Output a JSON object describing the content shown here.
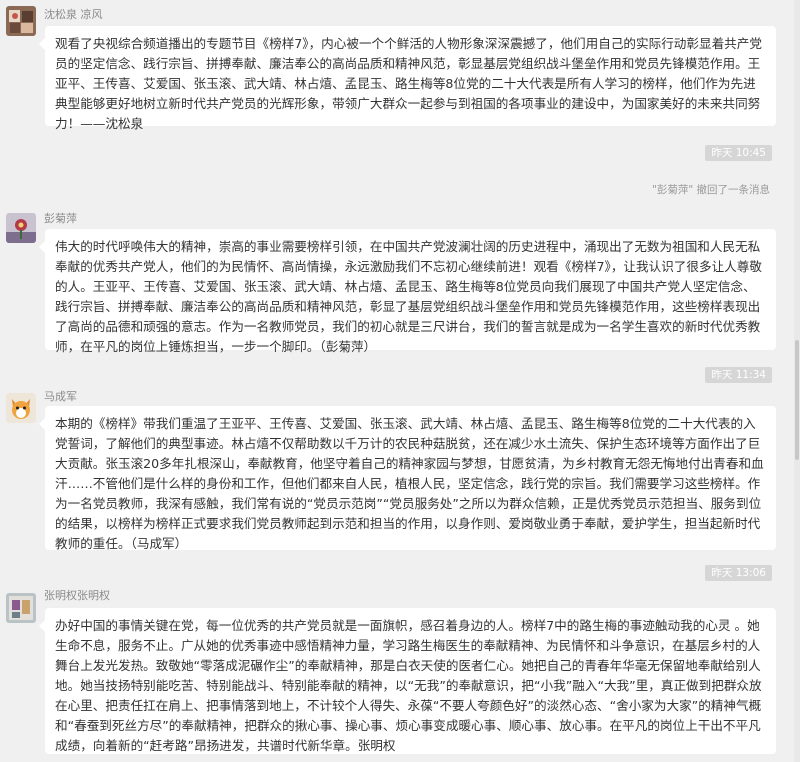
{
  "messages": [
    {
      "sender": "沈松泉 凉风",
      "text": "观看了央视综合频道播出的专题节目《榜样7》，内心被一个个鲜活的人物形象深深震撼了，他们用自己的实际行动彰显着共产党员的坚定信念、践行宗旨、拼搏奉献、廉洁奉公的高尚品质和精神风范，彰显基层党组织战斗堡垒作用和党员先锋模范作用。王亚平、王传喜、艾爱国、张玉滚、武大靖、林占熺、孟昆玉、路生梅等8位党的二十大代表是所有人学习的榜样，他们作为先进典型能够更好地树立新时代共产党员的光辉形象，带领广大群众一起参与到祖国的各项事业的建设中，为国家美好的未来共同努力！——沈松泉"
    },
    {
      "time": "昨天 10:45",
      "recall": "\"彭菊萍\" 撤回了一条消息",
      "sender": "彭菊萍",
      "text": "伟大的时代呼唤伟大的精神，崇高的事业需要榜样引领，在中国共产党波澜壮阔的历史进程中，涌现出了无数为祖国和人民无私奉献的优秀共产党人，他们的为民情怀、高尚情操，永远激励我们不忘初心继续前进！观看《榜样7》，让我认识了很多让人尊敬的人。王亚平、王传喜、艾爱国、张玉滚、武大靖、林占熺、孟昆玉、路生梅等8位党员向我们展现了中国共产党人坚定信念、践行宗旨、拼搏奉献、廉洁奉公的高尚品质和精神风范，彰显了基层党组织战斗堡垒作用和党员先锋模范作用，这些榜样表现出了高尚的品德和顽强的意志。作为一名教师党员，我们的初心就是三尺讲台，我们的誓言就是成为一名学生喜欢的新时代优秀教师，在平凡的岗位上锤炼担当，一步一个脚印。（彭菊萍）"
    },
    {
      "time": "昨天 11:34",
      "sender": "马成军",
      "text": "本期的《榜样》带我们重温了王亚平、王传喜、艾爱国、张玉滚、武大靖、林占熺、孟昆玉、路生梅等8位党的二十大代表的入党誓词，了解他们的典型事迹。林占熺不仅帮助数以千万计的农民种菇脱贫，还在减少水土流失、保护生态环境等方面作出了巨大贡献。张玉滚20多年扎根深山，奉献教育，他坚守着自己的精神家园与梦想，甘愿贫清，为乡村教育无怨无悔地付出青春和血汗……不管他们是什么样的身份和工作，但他们都来自人民，植根人民，坚定信念，践行党的宗旨。我们需要学习这些榜样。作为一名党员教师，我深有感触，我们常有说的“党员示范岗”“党员服务处”之所以为群众信赖，正是优秀党员示范担当、服务到位的结果，以榜样为榜样正式要求我们党员教师起到示范和担当的作用，以身作则、爱岗敬业勇于奉献，爱护学生，担当起新时代教师的重任。（马成军）"
    },
    {
      "time": "昨天 13:06",
      "sender": "张明权张明权",
      "text": "办好中国的事情关键在党，每一位优秀的共产党员就是一面旗帜，感召着身边的人。榜样7中的路生梅的事迹触动我的心灵 。她生命不息，服务不止。广从她的优秀事迹中感悟精神力量，学习路生梅医生的奉献精神、为民情怀和斗争意识，在基层乡村的人舞台上发光发热。致敬她“零落成泥碾作尘”的奉献精神，那是白衣天使的医者仁心。她把自己的青春年华毫无保留地奉献给别人地。她当技扬特别能吃苦、特别能战斗、特别能奉献的精神，以“无我”的奉献意识，把“小我”融入“大我”里，真正做到把群众放在心里、把责任扛在肩上、把事情落到地上，不计较个人得失、永葆“不要人夸颜色好”的淡然心态、“舍小家为大家”的精神气概和“春蚕到死丝方尽”的奉献精神，把群众的揪心事、操心事、烦心事变成暖心事、顺心事、放心事。在平凡的岗位上干出不平凡成绩，向着新的“赶考路”昂扬进发，共谱时代新华章。张明权"
    }
  ]
}
